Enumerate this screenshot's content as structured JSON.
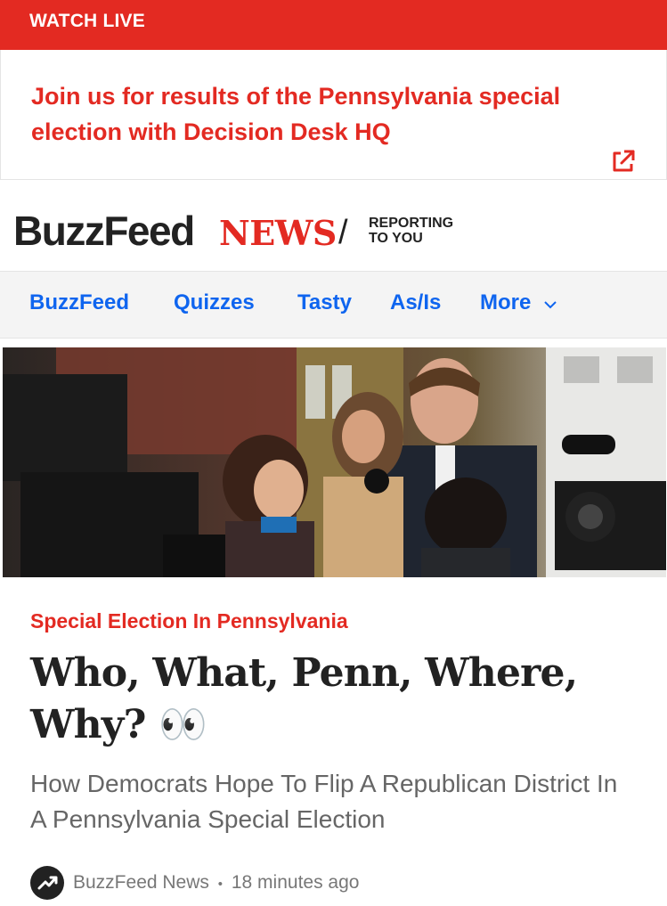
{
  "banner": {
    "label": "WATCH LIVE"
  },
  "promo": {
    "text": "Join us for results of the Pennsylvania special election with Decision Desk HQ",
    "icon": "external-link-icon"
  },
  "brand": {
    "logo_buzz": "BuzzFeed",
    "logo_news": "NEWS",
    "slash": "/",
    "tagline_line1": "REPORTING",
    "tagline_line2": "TO YOU"
  },
  "nav": {
    "items": [
      {
        "label": "BuzzFeed"
      },
      {
        "label": "Quizzes"
      },
      {
        "label": "Tasty"
      },
      {
        "label": "As/Is"
      },
      {
        "label": "More"
      }
    ]
  },
  "article": {
    "kicker": "Special Election In Pennsylvania",
    "headline": "Who, What, Penn, Where, Why?",
    "emoji": "👀",
    "dek": "How Democrats Hope To Flip A Republican District In A Pennsylvania Special Election",
    "author": "BuzzFeed News",
    "separator": "•",
    "time": "18 minutes ago"
  },
  "colors": {
    "accent": "#e32a22",
    "link": "#0f65ef",
    "text": "#222222",
    "muted": "#666666"
  }
}
